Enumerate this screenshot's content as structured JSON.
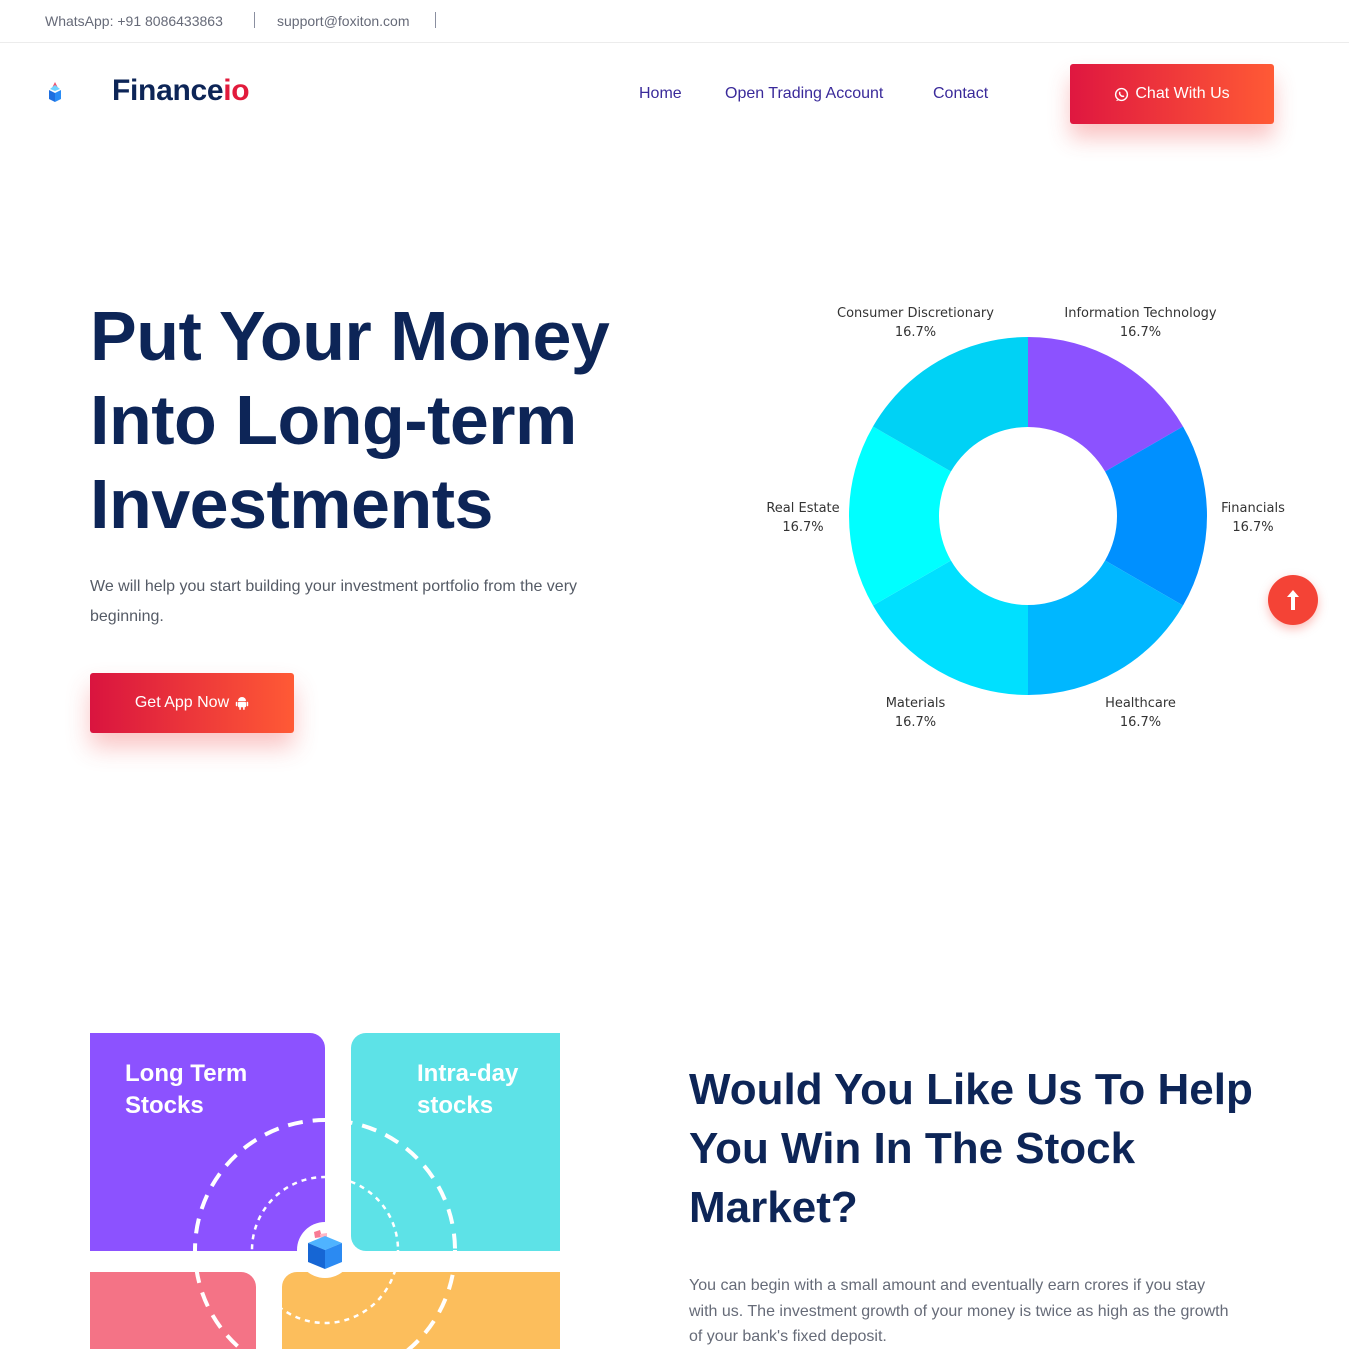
{
  "topbar": {
    "whatsapp": "WhatsApp: +91 8086433863",
    "email": "support@foxiton.com"
  },
  "brand": {
    "name_main": "Finance",
    "name_accent": "io",
    "logo_icon": "cube-icon"
  },
  "nav": {
    "items": [
      "Home",
      "Open Trading Account",
      "Contact"
    ],
    "cta_label": "Chat With Us",
    "cta_icon": "whatsapp-icon"
  },
  "hero": {
    "title_lines": [
      "Put Your Money",
      "Into Long-term",
      "Investments"
    ],
    "subtitle": "We will help you start building your investment portfolio from the very beginning.",
    "button_label": "Get App Now",
    "button_icon": "android-icon"
  },
  "chart_data": {
    "type": "pie",
    "categories": [
      "Information Technology",
      "Financials",
      "Healthcare",
      "Materials",
      "Real Estate",
      "Consumer Discretionary"
    ],
    "values": [
      16.7,
      16.7,
      16.7,
      16.7,
      16.7,
      16.7
    ],
    "value_labels": [
      "16.7%",
      "16.7%",
      "16.7%",
      "16.7%",
      "16.7%",
      "16.7%"
    ],
    "colors": [
      "#8c52ff",
      "#0090ff",
      "#00b7ff",
      "#00e0ff",
      "#00ffff",
      "#00d2f5"
    ],
    "legend": "none"
  },
  "scroll_top_icon": "arrow-up-icon",
  "features": {
    "tiles": [
      {
        "label_lines": [
          "Long Term",
          "Stocks"
        ],
        "color": "#8c52ff"
      },
      {
        "label_lines": [
          "Intra-day",
          "stocks"
        ],
        "color": "#5de2e7"
      },
      {
        "label_lines": [],
        "color": "#f47386"
      },
      {
        "label_lines": [],
        "color": "#fcbe5c"
      }
    ],
    "center_icon": "cube-icon",
    "title_lines": [
      "Would You Like Us To Help",
      "You Win In The Stock",
      "Market?"
    ],
    "description": "You can begin with a small amount and eventually earn crores if you stay with us. The investment growth of your money is twice as high as the growth of your bank's fixed deposit."
  }
}
